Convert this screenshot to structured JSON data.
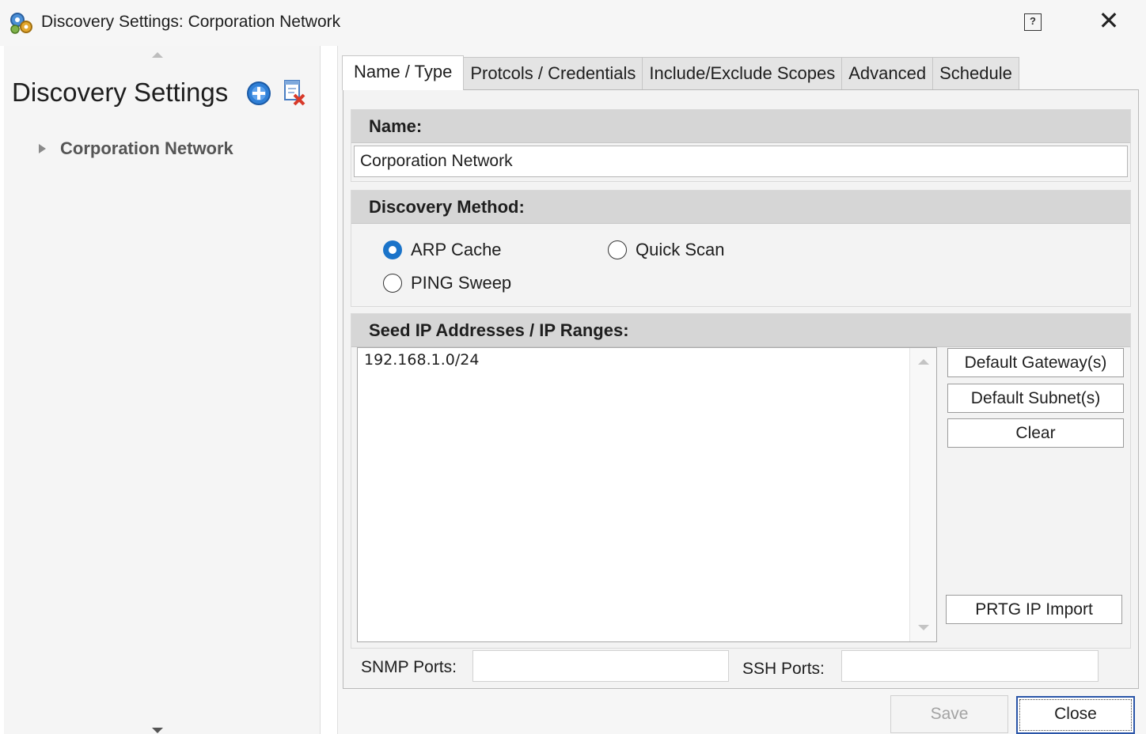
{
  "window": {
    "title": "Discovery Settings: Corporation Network",
    "icon": "gears-icon",
    "help_icon": "help-icon",
    "help_glyph": "?",
    "close_glyph": "✕"
  },
  "sidebar": {
    "title": "Discovery Settings",
    "add_icon": "add-circle-icon",
    "delete_icon": "delete-document-icon",
    "tree": [
      {
        "label": "Corporation Network",
        "expanded": false
      }
    ]
  },
  "tabs": [
    {
      "label": "Name / Type",
      "active": true
    },
    {
      "label": "Protcols / Credentials",
      "active": false
    },
    {
      "label": "Include/Exclude Scopes",
      "active": false
    },
    {
      "label": "Advanced",
      "active": false
    },
    {
      "label": "Schedule",
      "active": false
    }
  ],
  "name_section": {
    "header": "Name:",
    "value": "Corporation Network"
  },
  "discovery_method": {
    "header": "Discovery Method:",
    "options": [
      {
        "label": "ARP Cache",
        "checked": true
      },
      {
        "label": "Quick Scan",
        "checked": false
      },
      {
        "label": "PING Sweep",
        "checked": false
      }
    ]
  },
  "seed_ip": {
    "header": "Seed IP Addresses / IP Ranges:",
    "value": "192.168.1.0/24",
    "buttons": {
      "default_gateway": "Default Gateway(s)",
      "default_subnet": "Default Subnet(s)",
      "clear": "Clear",
      "prtg_import": "PRTG IP Import"
    }
  },
  "ports": {
    "snmp_label": "SNMP Ports:",
    "snmp_value": "",
    "ssh_label": "SSH Ports:",
    "ssh_value": ""
  },
  "footer": {
    "save_label": "Save",
    "save_enabled": false,
    "close_label": "Close"
  },
  "colors": {
    "accent": "#1a73c9",
    "header_bg": "#d6d6d6",
    "focus_border": "#2a55a8"
  }
}
